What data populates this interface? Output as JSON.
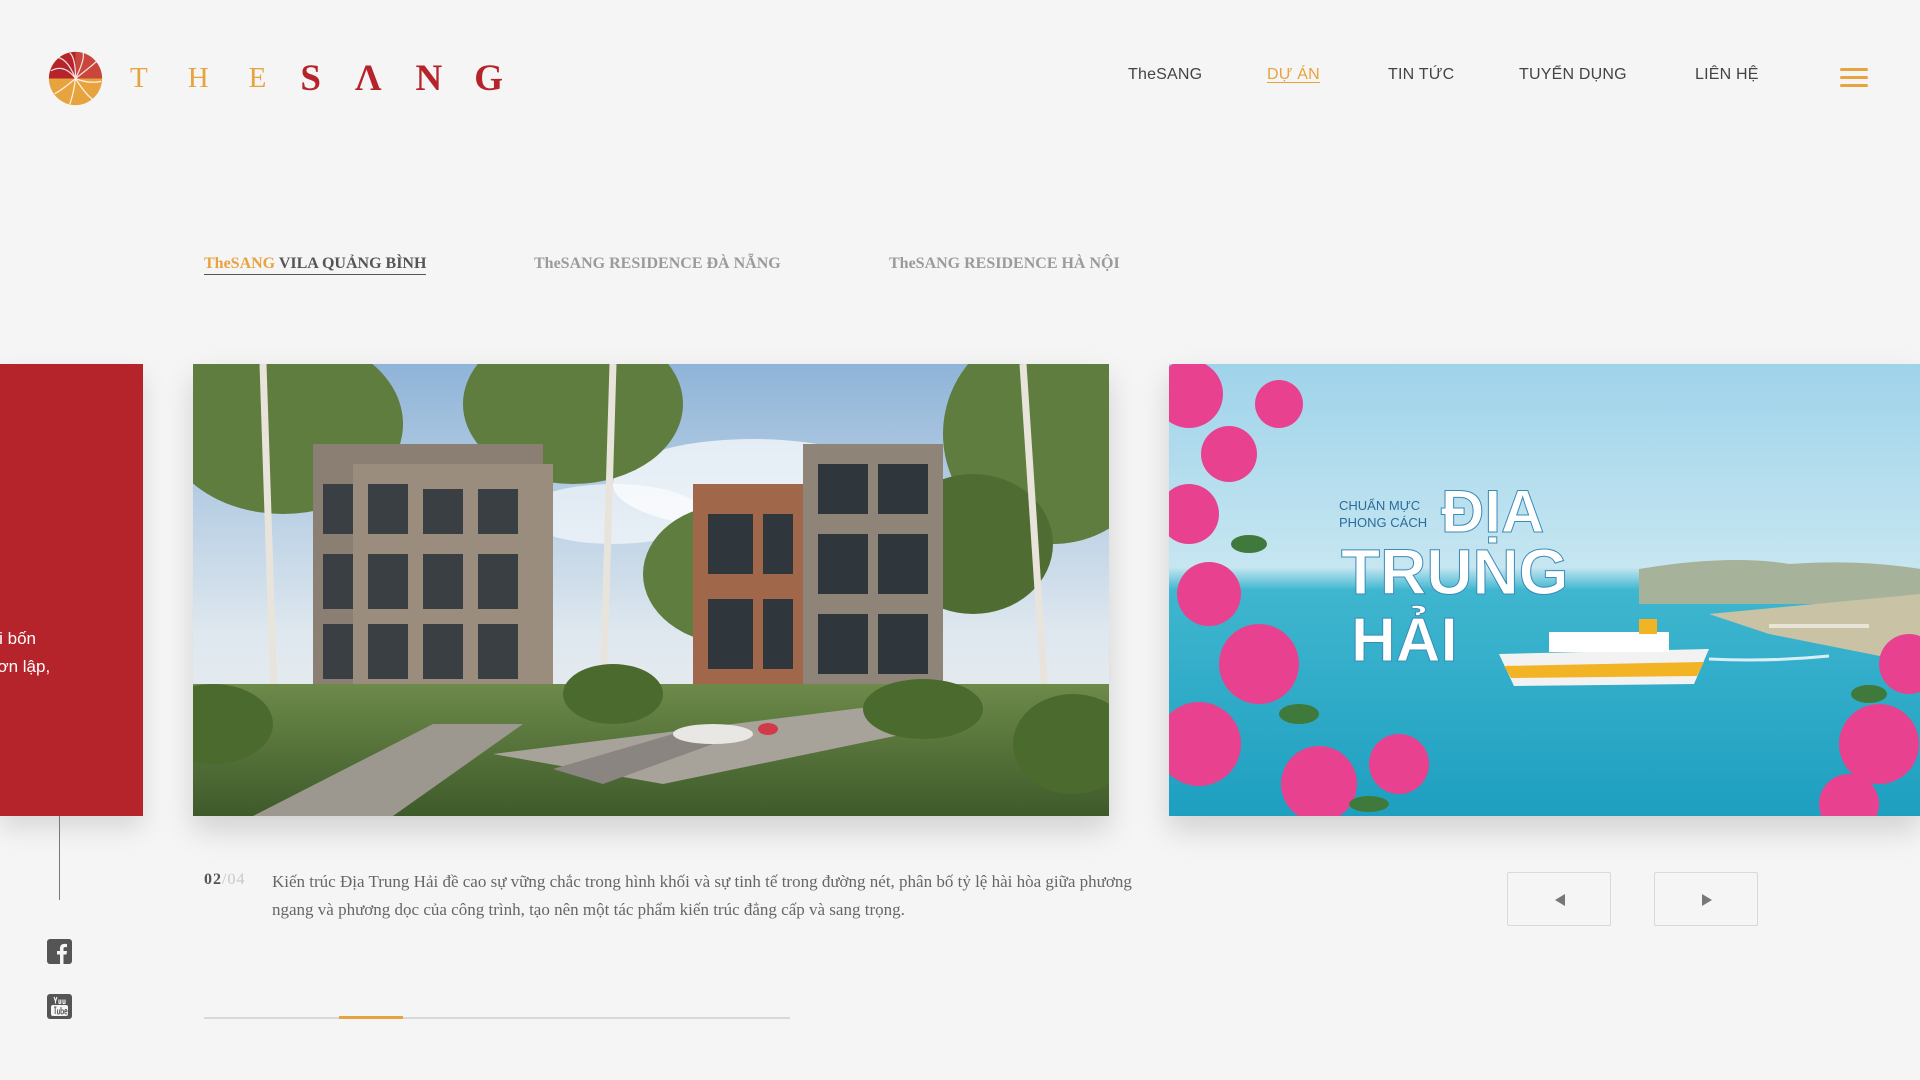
{
  "brand": {
    "logo_the": [
      "T",
      "H",
      "E"
    ],
    "logo_sang": [
      "S",
      "Λ",
      "N",
      "G"
    ],
    "colors": {
      "gold": "#e7a33e",
      "red": "#b5232b"
    }
  },
  "nav": {
    "items": [
      {
        "label": "TheSANG",
        "active": false
      },
      {
        "label": "DỰ ÁN",
        "active": true
      },
      {
        "label": "TIN TỨC",
        "active": false
      },
      {
        "label": "TUYỂN DỤNG",
        "active": false
      },
      {
        "label": "LIÊN HỆ",
        "active": false
      }
    ],
    "menu_icon": "hamburger-icon"
  },
  "project_tabs": [
    {
      "brand": "TheSANG",
      "label": " VILA QUẢNG BÌNH",
      "active": true
    },
    {
      "label": "TheSANG RESIDENCE ĐÀ NẴNG",
      "active": false
    },
    {
      "label": "TheSANG RESIDENCE HÀ NỘI",
      "active": false
    }
  ],
  "carousel": {
    "prev_slide_text": [
      "ới bốn",
      "đơn lập,"
    ],
    "counter_current": "02",
    "counter_total": "/04",
    "description": "Kiến trúc Địa Trung Hải đề cao sự vững chắc trong hình khối và sự tinh tế trong đường nét, phân bố tỷ lệ hài hòa giữa phương ngang và phương dọc của công trình, tạo nên một tác phẩm kiến trúc đẳng cấp và sang trọng.",
    "next_slide": {
      "small_line1": "CHUẨN MỰC",
      "small_line2": "PHONG CÁCH",
      "big_line1": "ĐỊA",
      "big_line2": "TRUNG",
      "big_line3": "HẢI"
    },
    "prev_icon": "triangle-left-icon",
    "next_icon": "triangle-right-icon",
    "progress": 0.25
  },
  "social": {
    "facebook_icon": "facebook-icon",
    "youtube_icon": "youtube-icon"
  }
}
